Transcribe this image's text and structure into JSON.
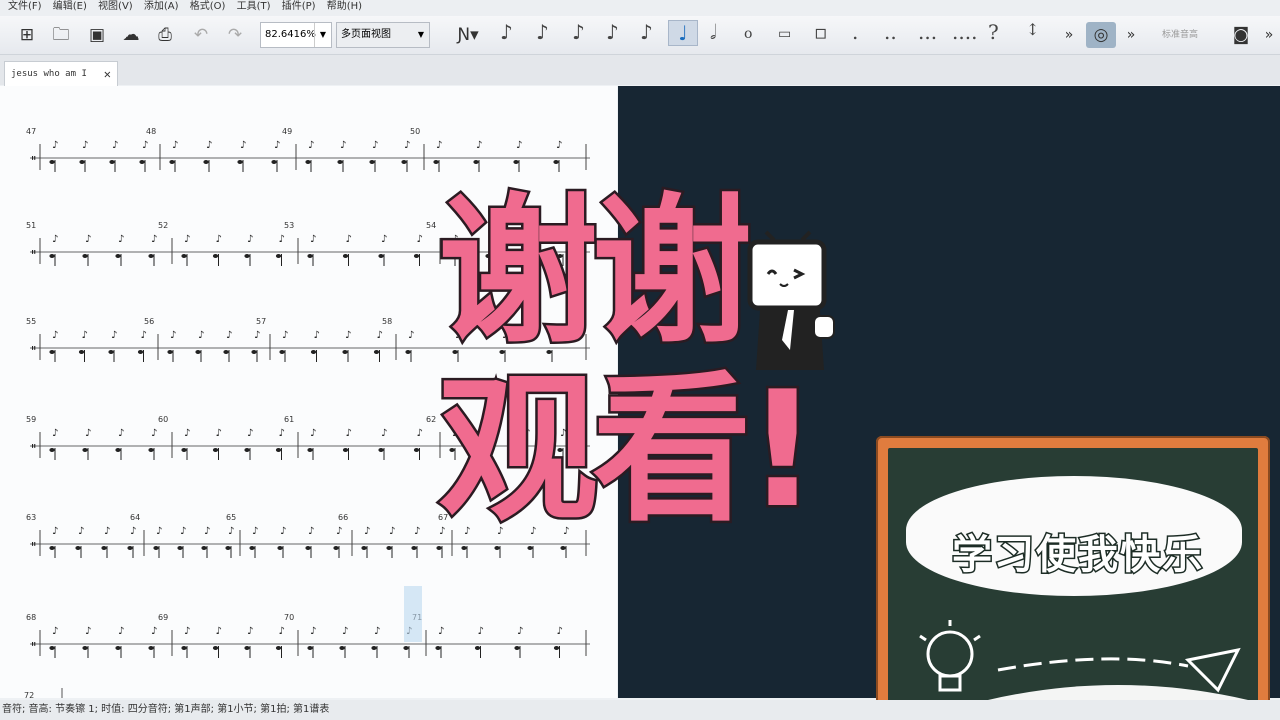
{
  "menubar": {
    "items": [
      "文件(F)",
      "编辑(E)",
      "视图(V)",
      "添加(A)",
      "格式(O)",
      "工具(T)",
      "插件(P)",
      "帮助(H)"
    ]
  },
  "toolbar": {
    "zoom_value": "82.6416%",
    "view_mode": "多页面视图",
    "more_label": "»",
    "concert_pitch_label": "标准音高"
  },
  "tab": {
    "title": "jesus who am I",
    "close": "✕"
  },
  "score": {
    "measure_numbers": [
      "47",
      "48",
      "49",
      "50",
      "51",
      "52",
      "53",
      "54",
      "55",
      "56",
      "57",
      "58",
      "59",
      "60",
      "61",
      "62",
      "63",
      "64",
      "65",
      "66",
      "67",
      "68",
      "69",
      "70",
      "71",
      "72"
    ]
  },
  "overlay": {
    "thanks_line1": "谢谢",
    "thanks_line2": "观看!",
    "motto": "学习使我快乐"
  },
  "statusbar": {
    "text": "音符; 音高: 节奏镲 1; 时值: 四分音符; 第1声部; 第1小节; 第1拍; 第1谱表"
  },
  "colors": {
    "accent_pink": "#f06b8f",
    "dark_panel": "#172633",
    "chalkboard_frame": "#e07c3e",
    "chalkboard": "#283d34"
  }
}
